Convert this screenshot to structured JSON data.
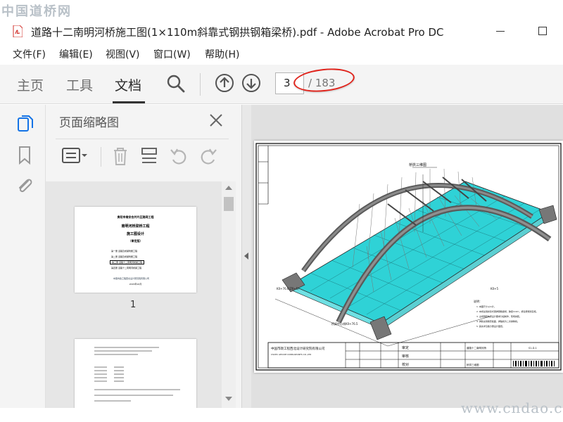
{
  "watermark_top": "中国道桥网",
  "watermark_bottom": "www.cndao.com",
  "window": {
    "title": "道路十二南明河桥施工图(1×110m斜靠式钢拱钢箱梁桥).pdf - Adobe Acrobat Pro DC"
  },
  "menu": [
    "文件(F)",
    "编辑(E)",
    "视图(V)",
    "窗口(W)",
    "帮助(H)"
  ],
  "toolbar": {
    "tabs": [
      "主页",
      "工具",
      "文档"
    ],
    "active_tab": "文档",
    "page_current": "3",
    "page_total": "/ 183"
  },
  "panel": {
    "title": "页面缩略图",
    "thumb1_label": "1",
    "thumb1": {
      "line1": "贵阳市南安合并片区路网工程",
      "line2": "南明河桥梁桥工程",
      "line3": "施工图设计",
      "line4": "（审定版）",
      "items": [
        "第一册  道路及桥梁附属工程",
        "第二册  道路及桥梁附属工程",
        "第三册  道路十二南明河桥梁工程",
        "第四册  道路十二南明河桥梁工程"
      ],
      "footer": "中国市政工程西北设计研究院有限公司",
      "date": "2015年10月"
    }
  },
  "drawing": {
    "section_label": "桥拱三维图",
    "left_label": "K0+76.6(Z0+5)",
    "bottom_label": "桥梁中心线K0+76.5",
    "right_label": "K0+5",
    "notes_title": "说明：",
    "notes": [
      "1. 本图尺寸以m计。",
      "2. 本桥采用斜靠式钢拱钢箱梁桥，跨径110m，桥宽按规划实施。",
      "3. 主桥钢结构按设计要求分段制作，现场拼装。",
      "4. 拱肋采用箱形截面，拱轴线为二次抛物线。",
      "5. 其余详见各分册设计图纸。"
    ],
    "title_block": {
      "company": "中国市政工程西北设计研究院有限公司",
      "company_en": "CSCEC AECOM CONSULTANTS CO.,LTD",
      "field_a": "审定",
      "field_b": "审核",
      "field_c": "校对",
      "sheet_title": "道路十二南明河桥",
      "drawing_name": "桥拱三维图",
      "drawing_no": "S1-D-1"
    }
  },
  "colors": {
    "accent_red": "#e0231b",
    "acrobat_blue": "#1473e6",
    "deck_cyan": "#2fd2d6"
  },
  "icons": [
    "pdf-file-icon",
    "search-icon",
    "page-up-icon",
    "page-down-icon",
    "page-thumbnails-icon",
    "bookmark-icon",
    "attachment-icon",
    "close-icon",
    "options-icon",
    "delete-icon",
    "extract-icon",
    "rotate-ccw-icon",
    "rotate-cw-icon"
  ]
}
